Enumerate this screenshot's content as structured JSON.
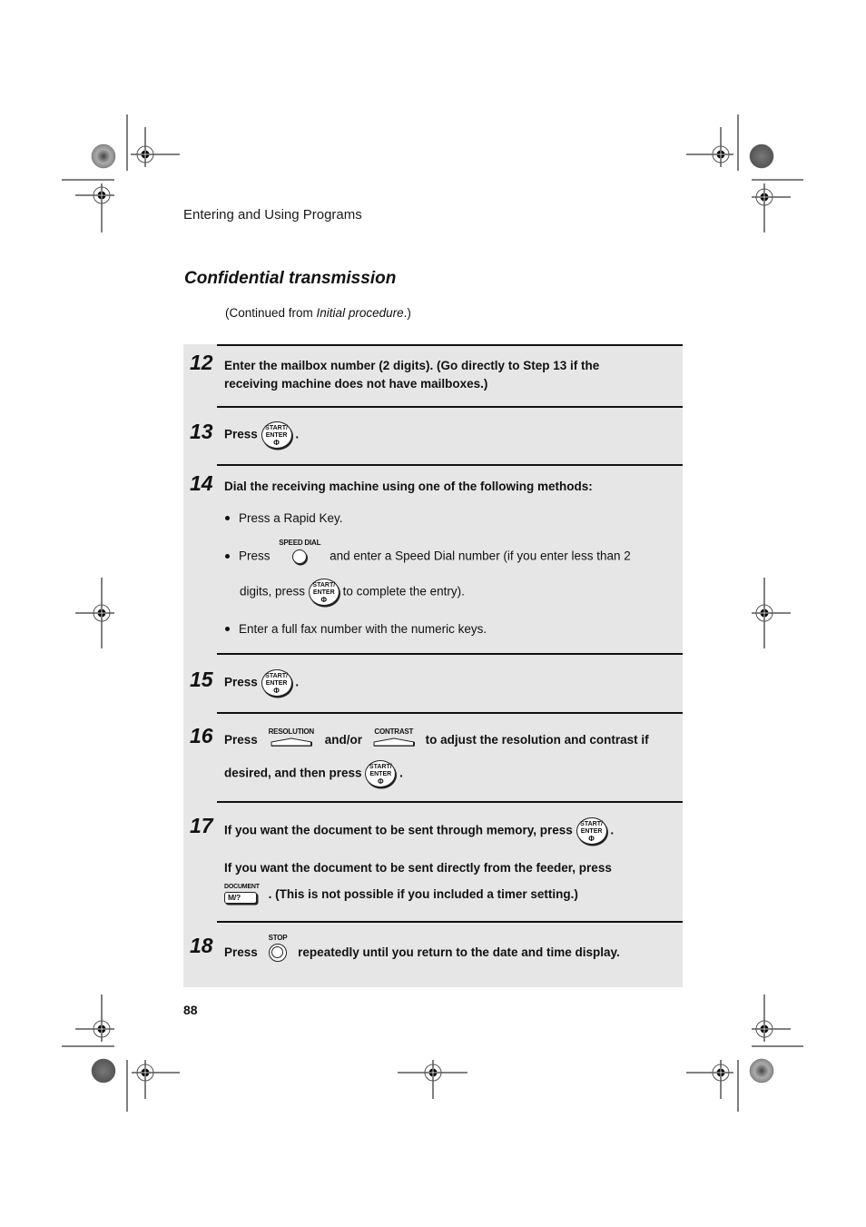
{
  "header": {
    "running_title": "Entering and Using Programs"
  },
  "section": {
    "title": "Confidential transmission",
    "continued_prefix": "(Continued from ",
    "continued_ref": "Initial procedure",
    "continued_suffix": ".)"
  },
  "keys": {
    "start_enter_line1": "START/",
    "start_enter_line2": "ENTER",
    "start_symbol": "Φ",
    "speed_dial": "SPEED DIAL",
    "resolution": "RESOLUTION",
    "contrast": "CONTRAST",
    "document": "DOCUMENT",
    "document_cap": "M/?",
    "stop": "STOP"
  },
  "steps": [
    {
      "number": "12",
      "line1": "Enter the mailbox number (2 digits). (Go directly to Step 13 if the",
      "line2": "receiving machine does not have mailboxes.)"
    },
    {
      "number": "13",
      "before": "Press",
      "after": "."
    },
    {
      "number": "14",
      "intro": "Dial the receiving machine using one of the following methods:",
      "bullets": [
        "Press a Rapid Key.",
        "and enter a Speed Dial number (if you enter less than 2",
        "Enter a full fax number with the numeric keys."
      ],
      "bullet2_prefix": "Press",
      "bullet2_cont_before": "digits, press",
      "bullet2_cont_after": "to complete the entry)."
    },
    {
      "number": "15",
      "before": "Press",
      "after": "."
    },
    {
      "number": "16",
      "before": "Press",
      "middle": "and/or",
      "after": "to adjust the resolution and contrast if",
      "line2_before": "desired, and then press",
      "line2_after": "."
    },
    {
      "number": "17",
      "line1_before": "If you want the document to be sent through memory, press",
      "line1_after": ".",
      "line2": "If you want the document to be sent directly from the feeder, press",
      "line3_after": ". (This is not possible if you included a timer setting.)"
    },
    {
      "number": "18",
      "before": "Press",
      "after": "repeatedly until you return to the date and time display."
    }
  ],
  "footer": {
    "page_number": "88"
  }
}
